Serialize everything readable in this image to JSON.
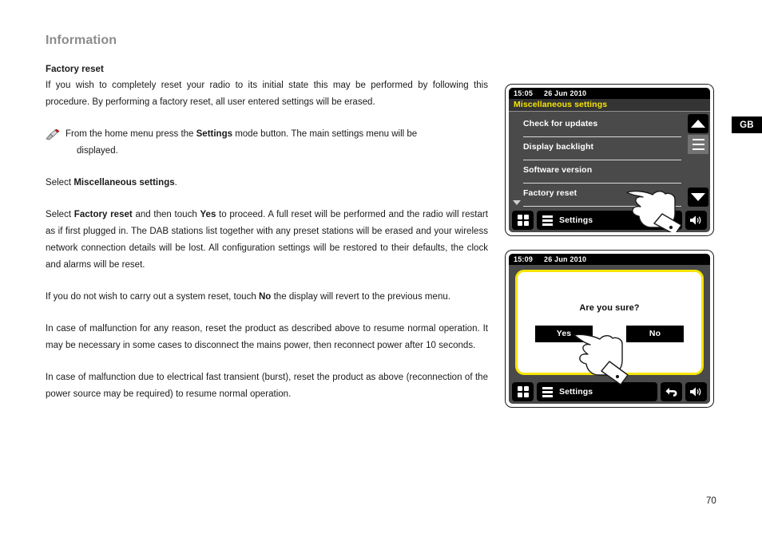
{
  "page": {
    "title": "Information",
    "number": "70",
    "region_badge": "GB"
  },
  "article": {
    "heading": "Factory reset",
    "intro": "If you wish to completely reset your radio to its initial state this may be performed by following this procedure. By performing a factory reset, all user entered settings will be erased.",
    "bullet": {
      "icon": "pen-tool-icon",
      "line1_a": "From the home menu press the ",
      "line1_b": "Settings",
      "line1_c": " mode button. The main settings menu will be",
      "line2": "displayed."
    },
    "select_misc_a": "Select ",
    "select_misc_b": "Miscellaneous settings",
    "select_misc_c": ".",
    "para_reset_a": "Select ",
    "para_reset_b": "Factory reset",
    "para_reset_c": " and then touch ",
    "para_reset_d": "Yes",
    "para_reset_e": " to proceed. A full reset will be performed and the radio will restart as if first plugged in. The DAB stations list together with any preset stations will be erased and your wireless network connection details will be lost. All configuration settings will be restored to their defaults, the clock and alarms will be reset.",
    "para_no_a": "If you do not wish to carry out a system reset, touch ",
    "para_no_b": "No",
    "para_no_c": " the display will revert to the previous menu.",
    "para_malfunction": "In case of malfunction for any reason, reset the product as described above to resume normal operation. It may be necessary in some cases to disconnect the mains power, then reconnect power after 10 seconds.",
    "para_burst": "In case of malfunction due to electrical fast transient (burst), reset the product as above (reconnection of the power source may be required) to resume normal operation."
  },
  "screens": [
    {
      "id": "settings-menu",
      "status": {
        "time": "15:05",
        "date": "26 Jun 2010"
      },
      "title": "Miscellaneous settings",
      "menu_items": [
        "Check for updates",
        "Display backlight",
        "Software version",
        "Factory reset"
      ],
      "scroll": {
        "up_icon": "triangle-up-icon",
        "thumb_icon": "scroll-thumb-icon",
        "down_icon": "triangle-down-icon",
        "more_icon": "triangle-down-small-icon"
      },
      "toolbar": {
        "grid_icon": "grid-menu-icon",
        "menu_icon": "hamburger-icon",
        "settings_label": "Settings",
        "volume_icon": "speaker-icon"
      },
      "cursor": "pointing-hand-icon"
    },
    {
      "id": "confirm-dialog",
      "status": {
        "time": "15:09",
        "date": "26 Jun 2010"
      },
      "question": "Are you sure?",
      "buttons": {
        "yes": "Yes",
        "no": "No"
      },
      "toolbar": {
        "grid_icon": "grid-menu-icon",
        "menu_icon": "hamburger-icon",
        "settings_label": "Settings",
        "back_icon": "back-arrow-icon",
        "volume_icon": "speaker-icon"
      },
      "cursor": "pointing-hand-icon"
    }
  ],
  "colors": {
    "accent_yellow": "#f5e400",
    "screen_bg": "#4a4a4a",
    "status_bg": "#000000",
    "heading_gray": "#8c8c8c"
  }
}
